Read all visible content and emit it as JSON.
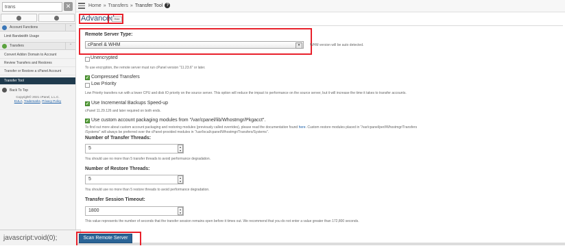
{
  "sidebar": {
    "search_value": "trans",
    "clear_icon": "close-icon",
    "sections": [
      {
        "label": "Account Functions",
        "icon": "user-icon",
        "color": "#3a77b8"
      },
      {
        "label": "Transfers",
        "icon": "transfer-icon",
        "color": "#5aa23d"
      }
    ],
    "items_account": [
      "Limit Bandwidth Usage"
    ],
    "items_transfers": [
      "Convert Addon Domain to Account",
      "Review Transfers and Restores",
      "Transfer or Restore a cPanel Account",
      "Transfer Tool"
    ],
    "active_item": "Transfer Tool",
    "back_to_top": "Back To Top",
    "copyright_line1": "Copyright© 2021 cPanel, L.L.C.",
    "copyright_eula": "EULA",
    "copyright_trademarks": "Trademarks",
    "copyright_privacy": "Privacy Policy"
  },
  "status_bar": {
    "text": "javascript:void(0);"
  },
  "topbar": {
    "breadcrumb": {
      "home": "Home",
      "sep1": "»",
      "transfers": "Transfers",
      "sep2": "»",
      "current": "Transfer Tool"
    },
    "help_icon": "?"
  },
  "main": {
    "section_title": "Advanced",
    "hide_label": "Hide",
    "remote_server_type_label": "Remote Server Type:",
    "remote_server_type_value": "cPanel & WHM",
    "remote_server_type_note": "WHM version will be auto detected.",
    "unencrypted_label": "Unencrypted",
    "unencrypted_checked": false,
    "encryption_note": "To use encryption, the remote server must run cPanel version \"11.23.6\" or later.",
    "compressed_label": "Compressed Transfers",
    "compressed_checked": true,
    "low_priority_label": "Low Priority",
    "low_priority_checked": false,
    "low_priority_note": "Low Priority transfers run with a lower CPU and disk IO priority on the source server. This option will reduce the impact to performance on the source server, but it will increase the time it takes to transfer accounts.",
    "incremental_label": "Use Incremental Backups Speed-up",
    "incremental_checked": true,
    "incremental_note": "cPanel 11.29.126 and later required on both ends.",
    "custom_pkg_label": "Use custom account packaging modules from \"/var/cpanel/lib/Whostmgr/Pkgacct\".",
    "custom_pkg_checked": true,
    "custom_pkg_note_line1_a": "To find out more about custom account packaging and restoring modules (previously called overrides), please read the documentation found ",
    "custom_pkg_note_link": "here",
    "custom_pkg_note_line1_b": ". Custom restore modules placed in \"/var/cpanel/perl/Whostmgr/Transfers",
    "custom_pkg_note_line2": "/Systems\" will always be preferred over the cPanel-provided modules in \"/usr/local/cpanel/Whostmgr/Transfers/Systems\".",
    "transfer_threads_label": "Number of Transfer Threads:",
    "transfer_threads_value": "5",
    "transfer_threads_note": "You should use no more than 5 transfer threads to avoid performance degradation.",
    "restore_threads_label": "Number of Restore Threads:",
    "restore_threads_value": "5",
    "restore_threads_note": "You should use no more than 5 restore threads to avoid performance degradation.",
    "timeout_label": "Transfer Session Timeout:",
    "timeout_value": "1800",
    "timeout_note": "This value represents the number of seconds that the transfer session remains open before it times out. We recommend that you do not enter a value greater than 172,800 seconds.",
    "scan_button": "Scan Remote Server"
  },
  "colors": {
    "highlight": "#e8202a",
    "active_item": "#1f3a4d",
    "button": "#2a6496",
    "check_green": "#5aa23d"
  }
}
